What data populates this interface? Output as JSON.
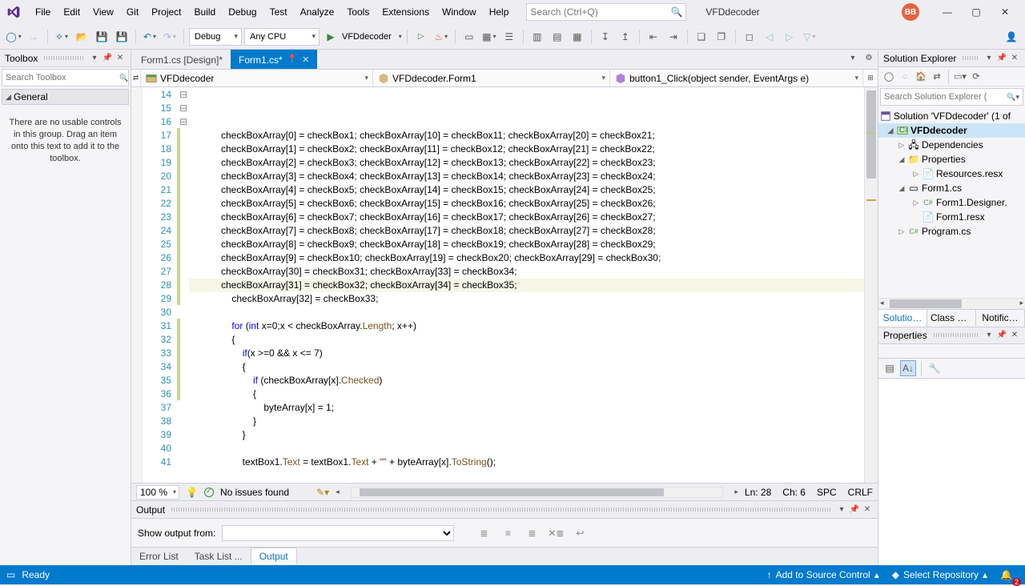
{
  "menu": [
    "File",
    "Edit",
    "View",
    "Git",
    "Project",
    "Build",
    "Debug",
    "Test",
    "Analyze",
    "Tools",
    "Extensions",
    "Window",
    "Help"
  ],
  "titleSearchPlaceholder": "Search (Ctrl+Q)",
  "appTitle": "VFDdecoder",
  "userInitials": "BB",
  "toolbar": {
    "config": "Debug",
    "platform": "Any CPU",
    "startTarget": "VFDdecoder"
  },
  "toolbox": {
    "title": "Toolbox",
    "searchPlaceholder": "Search Toolbox",
    "group": "General",
    "message": "There are no usable controls in this group. Drag an item onto this text to add it to the toolbox."
  },
  "tabs": {
    "inactive": "Form1.cs [Design]*",
    "active": "Form1.cs*"
  },
  "navbar": {
    "project": "VFDdecoder",
    "class": "VFDdecoder.Form1",
    "member": "button1_Click(object sender, EventArgs e)"
  },
  "code": {
    "startLine": 14,
    "lines": [
      "",
      "",
      "",
      "            checkBoxArray[0] = checkBox1; checkBoxArray[10] = checkBox11; checkBoxArray[20] = checkBox21;",
      "            checkBoxArray[1] = checkBox2; checkBoxArray[11] = checkBox12; checkBoxArray[21] = checkBox22;",
      "            checkBoxArray[2] = checkBox3; checkBoxArray[12] = checkBox13; checkBoxArray[22] = checkBox23;",
      "            checkBoxArray[3] = checkBox4; checkBoxArray[13] = checkBox14; checkBoxArray[23] = checkBox24;",
      "            checkBoxArray[4] = checkBox5; checkBoxArray[14] = checkBox15; checkBoxArray[24] = checkBox25;",
      "            checkBoxArray[5] = checkBox6; checkBoxArray[15] = checkBox16; checkBoxArray[25] = checkBox26;",
      "            checkBoxArray[6] = checkBox7; checkBoxArray[16] = checkBox17; checkBoxArray[26] = checkBox27;",
      "            checkBoxArray[7] = checkBox8; checkBoxArray[17] = checkBox18; checkBoxArray[27] = checkBox28;",
      "            checkBoxArray[8] = checkBox9; checkBoxArray[18] = checkBox19; checkBoxArray[28] = checkBox29;",
      "            checkBoxArray[9] = checkBox10; checkBoxArray[19] = checkBox20; checkBoxArray[29] = checkBox30;",
      "            checkBoxArray[30] = checkBox31; checkBoxArray[33] = checkBox34;",
      "            checkBoxArray[31] = checkBox32; checkBoxArray[34] = checkBox35;",
      "                checkBoxArray[32] = checkBox33;",
      "",
      "                for (int x=0;x < checkBoxArray.Length; x++)",
      "                {",
      "                    if(x >=0 && x <= 7)",
      "                    {",
      "                        if (checkBoxArray[x].Checked)",
      "                        {",
      "                            byteArray[x] = 1;",
      "                        }",
      "                    }",
      "",
      "                    textBox1.Text = textBox1.Text + \"\" + byteArray[x].ToString();"
    ],
    "highlightLine": 28,
    "foldMarks": {
      "31": "⊟",
      "33": "⊟",
      "35": "⊟"
    }
  },
  "editorStatus": {
    "zoom": "100 %",
    "issues": "No issues found",
    "ln": "Ln: 28",
    "ch": "Ch: 6",
    "spc": "SPC",
    "crlf": "CRLF"
  },
  "output": {
    "title": "Output",
    "showLabel": "Show output from:"
  },
  "bottomTabs": [
    "Error List",
    "Task List ...",
    "Output"
  ],
  "bottomActive": 2,
  "solutionExplorer": {
    "title": "Solution Explorer",
    "searchPlaceholder": "Search Solution Explorer (",
    "tree": {
      "solution": "Solution 'VFDdecoder' (1 of",
      "project": "VFDdecoder",
      "deps": "Dependencies",
      "props": "Properties",
      "resx": "Resources.resx",
      "form": "Form1.cs",
      "designer": "Form1.Designer.",
      "formresx": "Form1.resx",
      "program": "Program.cs"
    },
    "rightTabs": [
      "Solutio…",
      "Class V…",
      "Notific…"
    ]
  },
  "propertiesTitle": "Properties",
  "statusbar": {
    "ready": "Ready",
    "addSrc": "Add to Source Control",
    "selRepo": "Select Repository",
    "bellCount": "2"
  }
}
